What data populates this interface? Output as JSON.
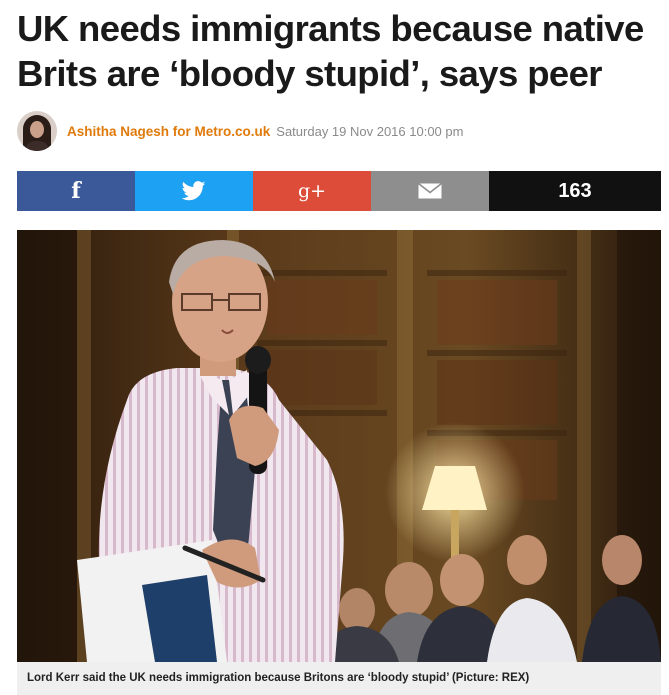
{
  "article": {
    "headline": "UK needs immigrants because native Brits are ‘bloody stupid’, says peer",
    "author": "Ashitha Nagesh for Metro.co.uk",
    "date": "Saturday 19 Nov 2016 10:00 pm"
  },
  "share": {
    "facebook_icon": "f",
    "gplus_icon": "g+",
    "comment_count": "163",
    "colors": {
      "facebook": "#3b5998",
      "twitter": "#1da1f2",
      "gplus": "#dd4b39",
      "email": "#8e8e8e",
      "comments": "#111111"
    }
  },
  "image": {
    "caption": "Lord Kerr said the UK needs immigration because Britons are ‘bloody stupid’ (Picture: REX)"
  },
  "theme": {
    "author_color": "#e07a0a"
  }
}
